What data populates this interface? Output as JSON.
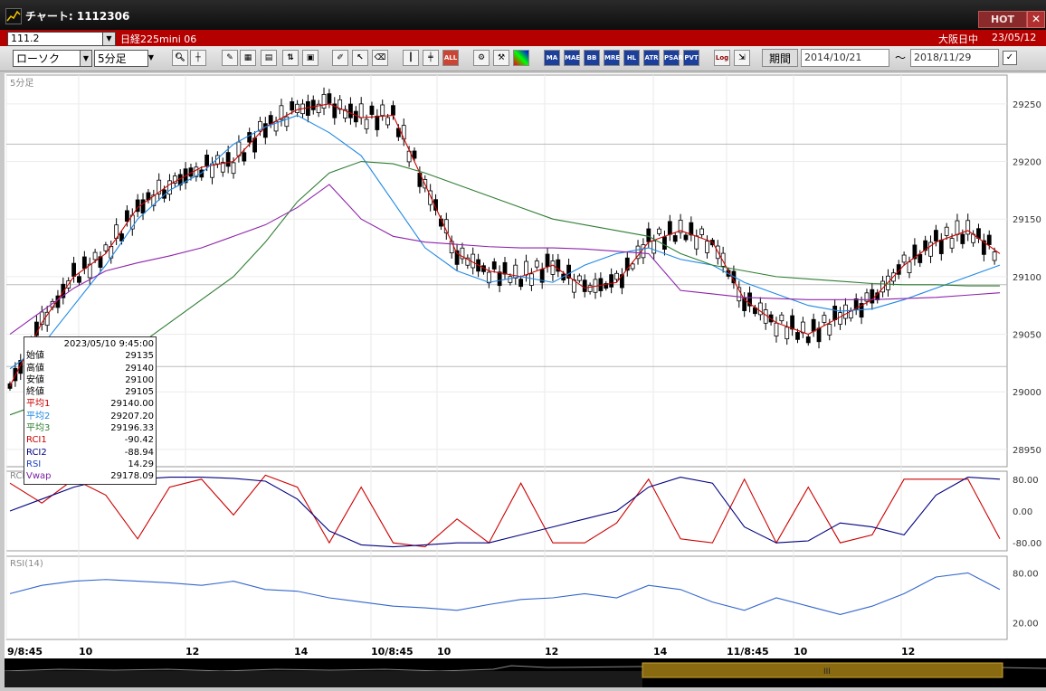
{
  "window": {
    "title": "チャート: 1112306",
    "hot_label": "HOT",
    "close_label": "✕"
  },
  "symbol_bar": {
    "code": "111.2",
    "name": "日経225mini 06",
    "session": "大阪日中",
    "date": "23/05/12"
  },
  "toolbar": {
    "chart_type": "ローソク",
    "timeframe": "5分足",
    "buttons": [
      "MA",
      "MAE",
      "BB",
      "HL",
      "ATR",
      "PSAR",
      "PVT",
      "Log"
    ],
    "period_label": "期間",
    "start_date": "2014/10/21",
    "end_date": "2018/11/29",
    "range_separator": "〜"
  },
  "main_panel": {
    "label": "5分足",
    "y_ticks": [
      "29250",
      "29200",
      "29150",
      "29100",
      "29050",
      "29000",
      "28950"
    ]
  },
  "rci_panel": {
    "label": "RCI",
    "y_ticks": [
      "80.00",
      "0.00",
      "-80.00"
    ]
  },
  "rsi_panel": {
    "label": "RSI(14)",
    "y_ticks": [
      "80.00",
      "20.00"
    ]
  },
  "x_axis": {
    "labels": [
      "9/8:45",
      "10",
      "12",
      "14",
      "10/8:45",
      "10",
      "12",
      "14",
      "11/8:45",
      "10",
      "12"
    ]
  },
  "info_box": {
    "timestamp": "2023/05/10 9:45:00",
    "rows": [
      {
        "label": "始値",
        "value": "29135",
        "color": "#000000"
      },
      {
        "label": "高値",
        "value": "29140",
        "color": "#000000"
      },
      {
        "label": "安値",
        "value": "29100",
        "color": "#000000"
      },
      {
        "label": "終値",
        "value": "29105",
        "color": "#000000"
      },
      {
        "label": "平均1",
        "value": "29140.00",
        "color": "#cc0000"
      },
      {
        "label": "平均2",
        "value": "29207.20",
        "color": "#1e88e5"
      },
      {
        "label": "平均3",
        "value": "29196.33",
        "color": "#2e7d32"
      },
      {
        "label": "RCI1",
        "value": "-90.42",
        "color": "#cc0000"
      },
      {
        "label": "RCI2",
        "value": "-88.94",
        "color": "#000080"
      },
      {
        "label": "RSI",
        "value": "14.29",
        "color": "#1e40c0"
      },
      {
        "label": "Vwap",
        "value": "29178.09",
        "color": "#7b1fa2"
      }
    ]
  },
  "colors": {
    "ma1": "#cc0000",
    "ma2": "#1e88e5",
    "ma3": "#2e7d32",
    "vwap": "#8e24aa",
    "rci1": "#cc0000",
    "rci2": "#000080",
    "rsi": "#3366cc",
    "accent": "#b50000"
  },
  "chart_data": {
    "type": "line",
    "price_axis_range": [
      28935,
      29275
    ],
    "series": [
      {
        "values": [
          29005,
          29060,
          29100,
          29120,
          29160,
          29180,
          29195,
          29200,
          29230,
          29245,
          29250,
          29238,
          29240,
          29180,
          29120,
          29105,
          29100,
          29110,
          29090,
          29095,
          29130,
          29140,
          29130,
          29080,
          29060,
          29050,
          29065,
          29080,
          29110,
          29130,
          29140,
          29120
        ]
      },
      {
        "values": [
          29020,
          29040,
          29075,
          29110,
          29150,
          29175,
          29190,
          29215,
          29230,
          29240,
          29225,
          29205,
          29165,
          29125,
          29105,
          29095,
          29100,
          29095,
          29110,
          29120,
          29125,
          29115,
          29110,
          29095,
          29085,
          29075,
          29070,
          29072,
          29080,
          29090,
          29100,
          29110
        ]
      },
      {
        "values": [
          28980,
          28990,
          29005,
          29020,
          29040,
          29060,
          29080,
          29100,
          29130,
          29165,
          29190,
          29200,
          29198,
          29190,
          29180,
          29170,
          29160,
          29150,
          29145,
          29140,
          29135,
          29120,
          29110,
          29105,
          29100,
          29098,
          29096,
          29094,
          29093,
          29093,
          29092,
          29092
        ]
      },
      {
        "values": [
          29050,
          29070,
          29090,
          29105,
          29112,
          29118,
          29125,
          29135,
          29145,
          29160,
          29180,
          29150,
          29135,
          29130,
          29128,
          29126,
          29125,
          29125,
          29124,
          29122,
          29120,
          29088,
          29085,
          29082,
          29081,
          29080,
          29080,
          29080,
          29081,
          29082,
          29084,
          29086
        ]
      }
    ],
    "rci1": [
      70,
      20,
      80,
      40,
      -70,
      60,
      80,
      -10,
      90,
      60,
      -80,
      60,
      -80,
      -90,
      -20,
      -80,
      70,
      -80,
      -80,
      -30,
      80,
      -70,
      -80,
      80,
      -80,
      60,
      -80,
      -60,
      80,
      80,
      80,
      -70
    ],
    "rci2": [
      0,
      30,
      60,
      80,
      80,
      85,
      85,
      82,
      75,
      30,
      -50,
      -85,
      -90,
      -85,
      -80,
      -80,
      -60,
      -40,
      -20,
      0,
      60,
      85,
      70,
      -40,
      -80,
      -75,
      -30,
      -40,
      -60,
      40,
      85,
      80
    ],
    "rsi": [
      55,
      65,
      70,
      72,
      70,
      68,
      65,
      70,
      60,
      58,
      50,
      45,
      40,
      38,
      35,
      42,
      48,
      50,
      55,
      50,
      65,
      60,
      45,
      35,
      50,
      40,
      30,
      40,
      55,
      75,
      80,
      60
    ]
  }
}
